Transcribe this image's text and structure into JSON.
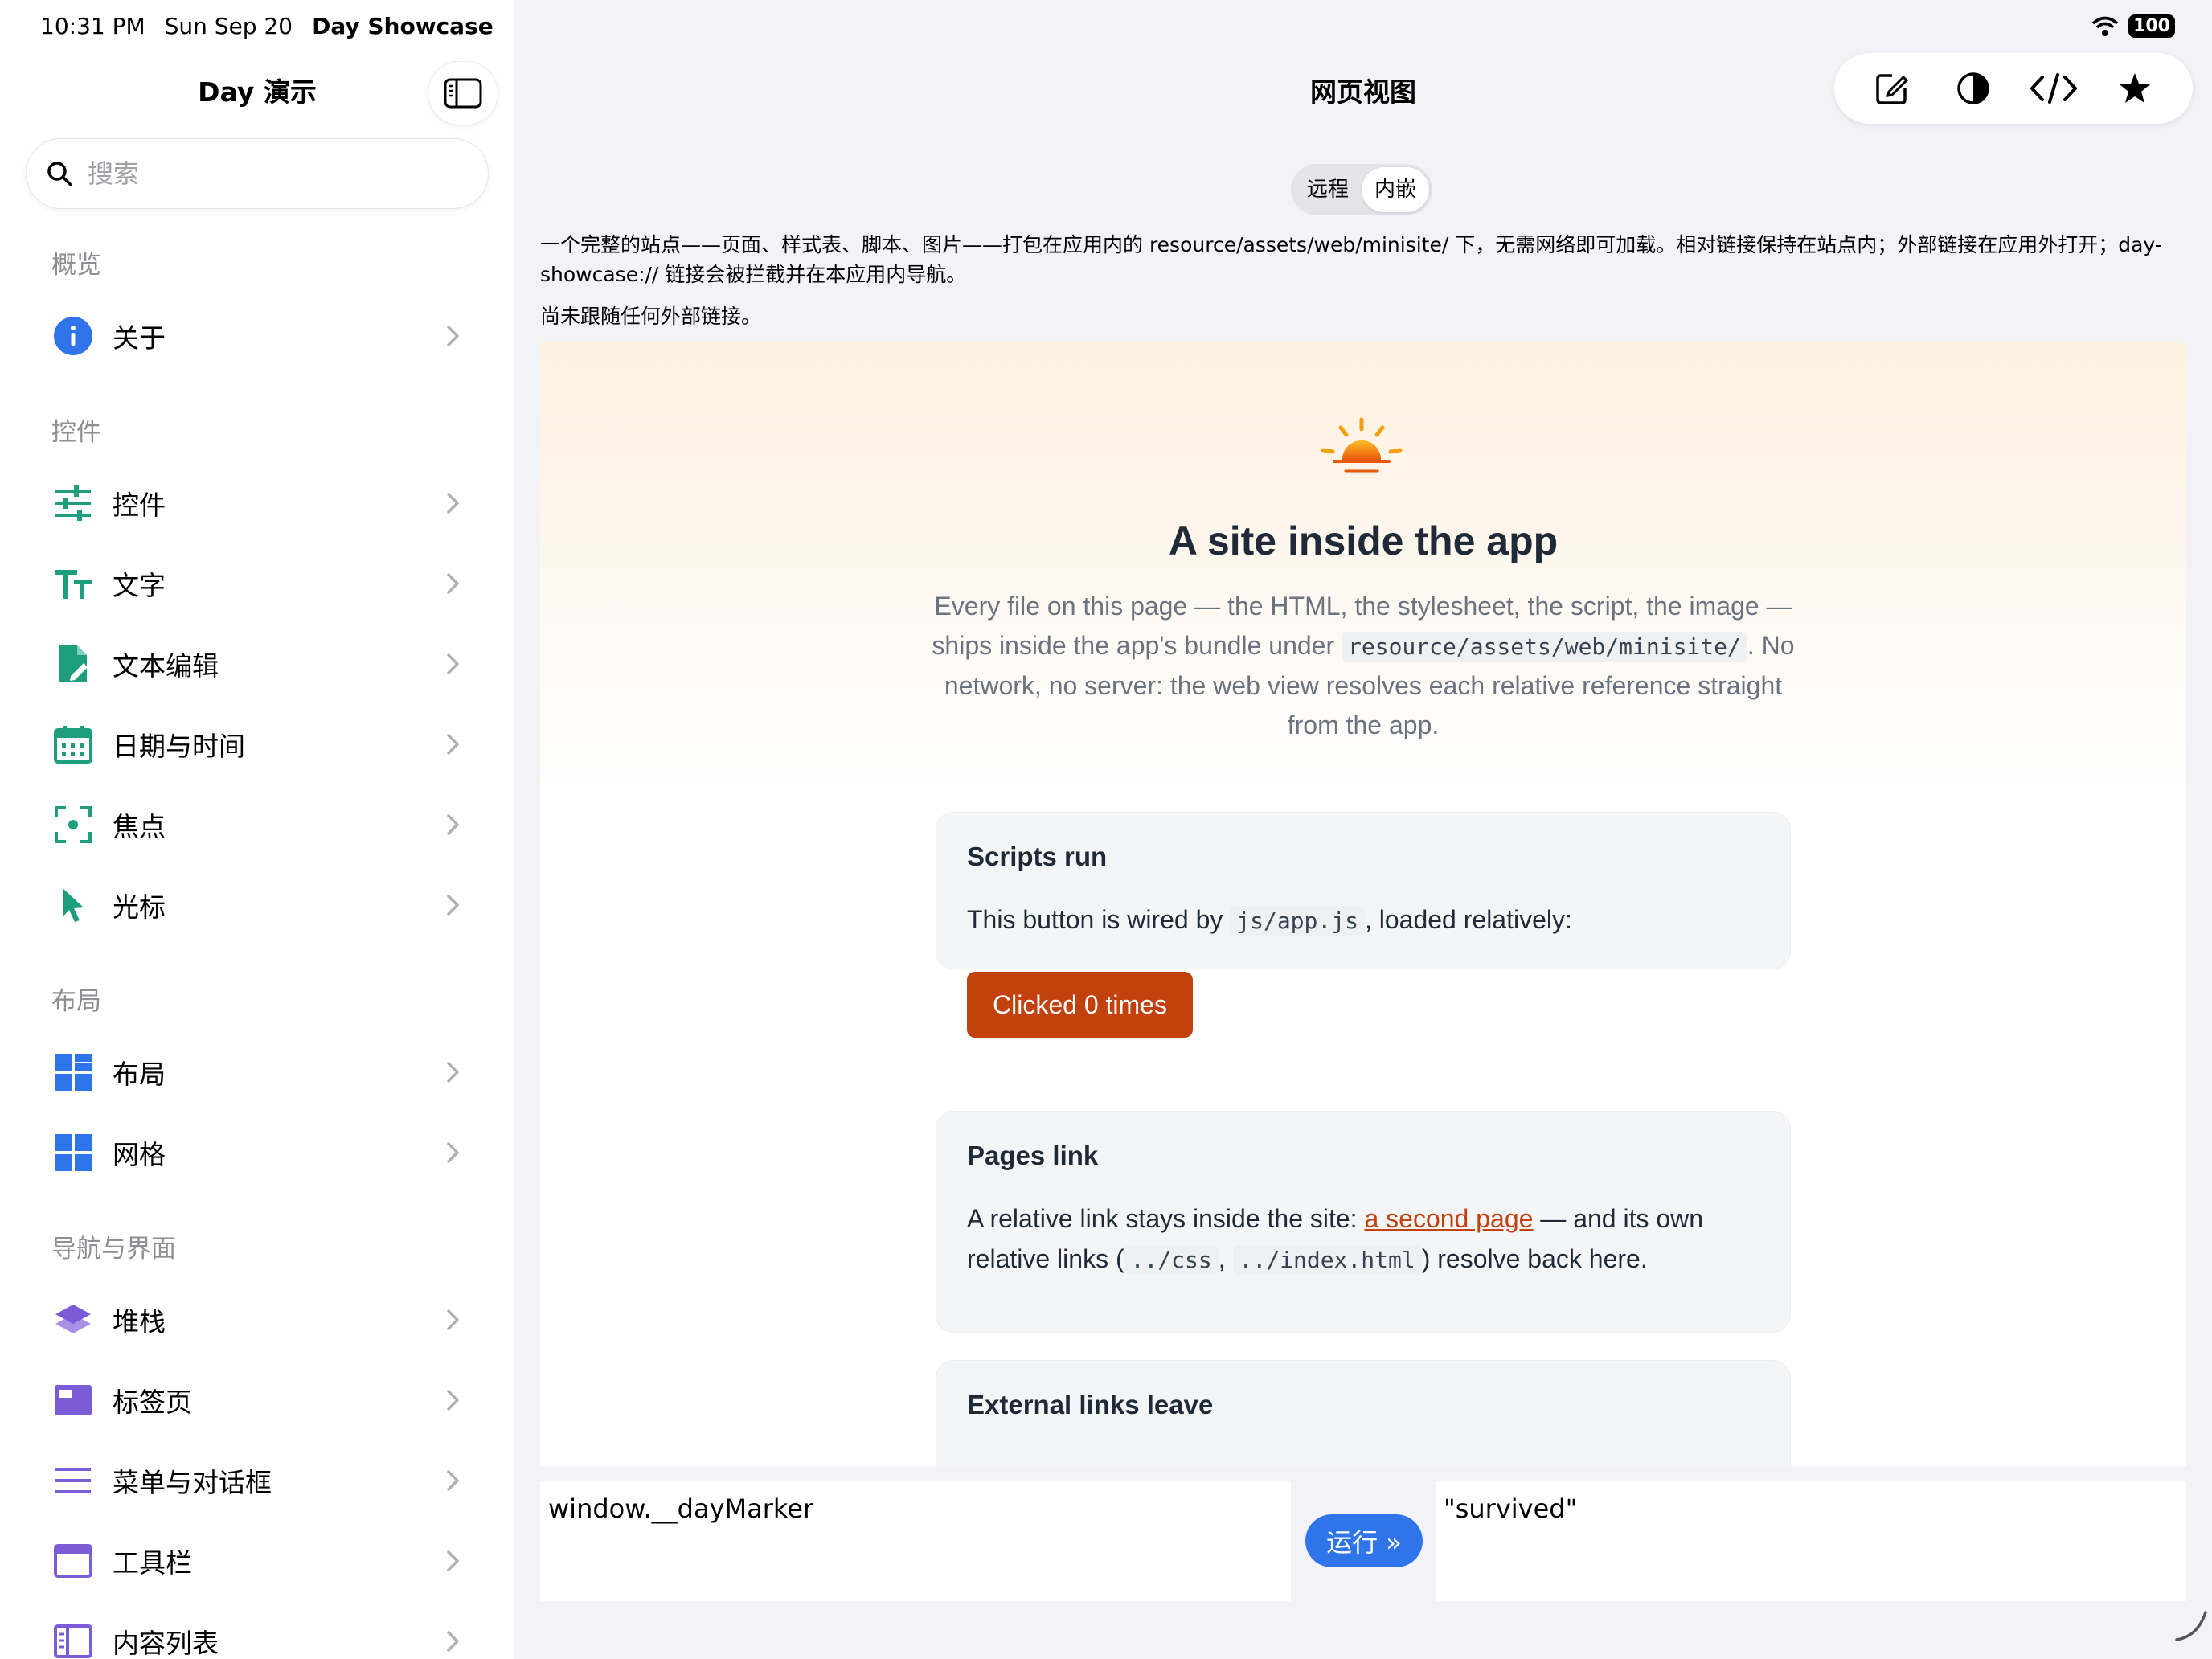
{
  "status_bar": {
    "time": "10:31 PM",
    "date": "Sun Sep 20",
    "app_name": "Day Showcase",
    "battery": "100"
  },
  "sidebar": {
    "title": "Day 演示",
    "search_placeholder": "搜索",
    "sections": [
      {
        "title": "概览",
        "items": [
          {
            "label": "关于",
            "icon": "info-icon"
          }
        ]
      },
      {
        "title": "控件",
        "items": [
          {
            "label": "控件",
            "icon": "sliders-icon"
          },
          {
            "label": "文字",
            "icon": "text-size-icon"
          },
          {
            "label": "文本编辑",
            "icon": "document-edit-icon"
          },
          {
            "label": "日期与时间",
            "icon": "calendar-icon"
          },
          {
            "label": "焦点",
            "icon": "focus-icon"
          },
          {
            "label": "光标",
            "icon": "cursor-icon"
          }
        ]
      },
      {
        "title": "布局",
        "items": [
          {
            "label": "布局",
            "icon": "layout-icon"
          },
          {
            "label": "网格",
            "icon": "grid-icon"
          }
        ]
      },
      {
        "title": "导航与界面",
        "items": [
          {
            "label": "堆栈",
            "icon": "stack-icon"
          },
          {
            "label": "标签页",
            "icon": "tabs-icon"
          },
          {
            "label": "菜单与对话框",
            "icon": "menu-icon"
          },
          {
            "label": "工具栏",
            "icon": "toolbar-icon"
          },
          {
            "label": "内容列表",
            "icon": "content-list-icon"
          }
        ]
      }
    ]
  },
  "main": {
    "title": "网页视图",
    "segments": [
      "远程",
      "内嵌"
    ],
    "selected_segment": "内嵌",
    "description": "一个完整的站点——页面、样式表、脚本、图片——打包在应用内的 resource/assets/web/minisite/ 下，无需网络即可加载。相对链接保持在站点内；外部链接在应用外打开；day-showcase:// 链接会被拦截并在本应用内导航。",
    "note": "尚未跟随任何外部链接。"
  },
  "webpage": {
    "title": "A site inside the app",
    "lead_1": "Every file on this page — the HTML, the stylesheet, the script, the image — ships inside the app's bundle under ",
    "lead_code": "resource/assets/web/minisite/",
    "lead_2": ". No network, no server: the web view resolves each relative reference straight from the app.",
    "card_scripts": {
      "title": "Scripts run",
      "text_1": "This button is wired by ",
      "code": "js/app.js",
      "text_2": ", loaded relatively:",
      "button": "Clicked 0 times"
    },
    "card_pages": {
      "title": "Pages link",
      "text_1": "A relative link stays inside the site: ",
      "link": "a second page",
      "text_2": " — and its own relative links (",
      "code_1": "../css",
      "sep": ", ",
      "code_2": "../index.html",
      "text_3": ") resolve back here."
    },
    "card_external": {
      "title": "External links leave"
    }
  },
  "console": {
    "input": "window.__dayMarker",
    "run_label": "运行 »",
    "output": "\"survived\""
  },
  "colors": {
    "accent_green": "#1f9e7e",
    "accent_blue": "#2f74e8",
    "accent_purple": "#7b5cd6",
    "brand_orange": "#c2410c"
  }
}
